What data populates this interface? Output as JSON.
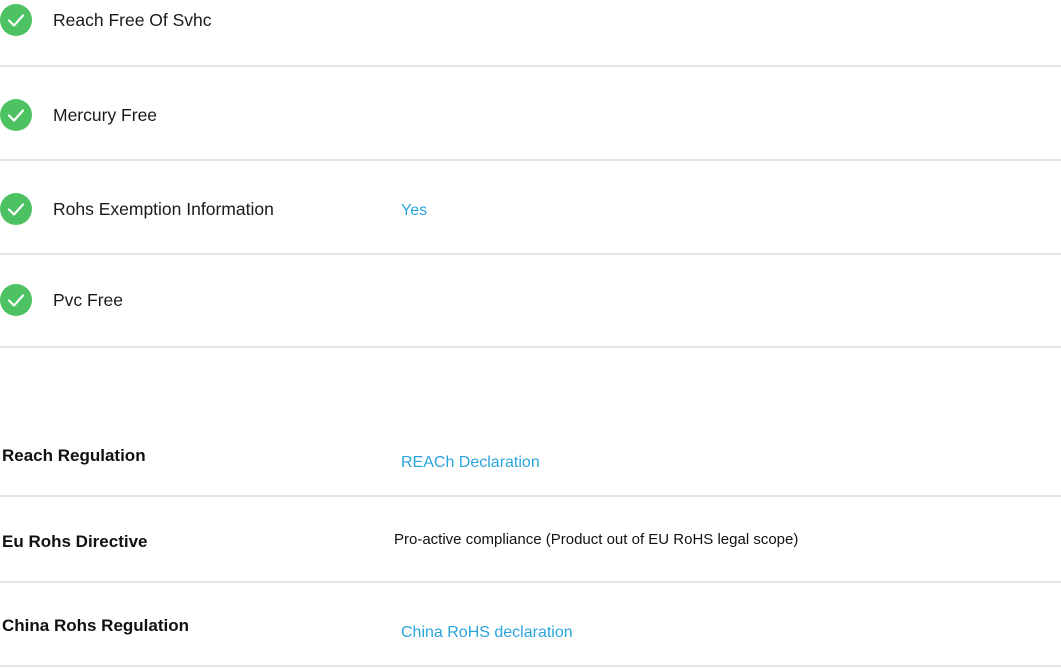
{
  "compliance_checks": [
    {
      "icon": "check-circle-icon",
      "label": "Reach Free Of Svhc",
      "value": ""
    },
    {
      "icon": "check-circle-icon",
      "label": "Mercury Free",
      "value": ""
    },
    {
      "icon": "check-circle-icon",
      "label": "Rohs Exemption Information",
      "value": "Yes"
    },
    {
      "icon": "check-circle-icon",
      "label": "Pvc Free",
      "value": ""
    }
  ],
  "regulations": [
    {
      "label": "Reach Regulation",
      "value": "REACh Declaration",
      "is_link": true
    },
    {
      "label": "Eu Rohs Directive",
      "value": "Pro-active compliance (Product out of EU RoHS legal scope)",
      "is_link": false
    },
    {
      "label": "China Rohs Regulation",
      "value": "China RoHS declaration",
      "is_link": true
    }
  ],
  "colors": {
    "check_green": "#4cc263",
    "link_blue": "#2aa4dc",
    "divider": "#e5e5e5"
  }
}
